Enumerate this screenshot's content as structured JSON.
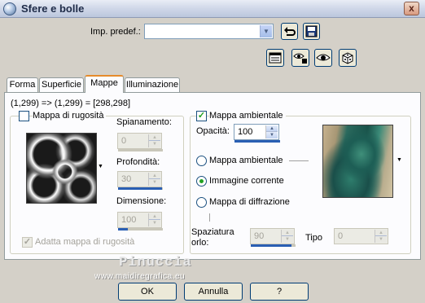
{
  "window": {
    "title": "Sfere e bolle",
    "close_glyph": "x"
  },
  "preset": {
    "label": "Imp. predef.:",
    "value": ""
  },
  "tabs": [
    {
      "label": "Forma"
    },
    {
      "label": "Superficie"
    },
    {
      "label": "Mappe"
    },
    {
      "label": "Illuminazione"
    }
  ],
  "coords_text": "(1,299) => (1,299) = [298,298]",
  "bump": {
    "checkbox_label": "Mappa di rugosità",
    "smoothing_label": "Spianamento:",
    "smoothing_value": "0",
    "depth_label": "Profondità:",
    "depth_value": "30",
    "size_label": "Dimensione:",
    "size_value": "100",
    "fit_label": "Adatta mappa di rugosità"
  },
  "env": {
    "checkbox_label": "Mappa ambientale",
    "opacity_label": "Opacità:",
    "opacity_value": "100",
    "radio_env": "Mappa ambientale",
    "radio_current": "Immagine corrente",
    "radio_diffraction": "Mappa di diffrazione",
    "spacing_label_1": "Spaziatura",
    "spacing_label_2": "orlo:",
    "spacing_value": "90",
    "type_label": "Tipo",
    "type_value": "0"
  },
  "watermark": {
    "line1": "Pinuccia",
    "line2": "www.maidiregrafica.eu"
  },
  "buttons": {
    "ok": "OK",
    "cancel": "Annulla",
    "help": "?"
  }
}
